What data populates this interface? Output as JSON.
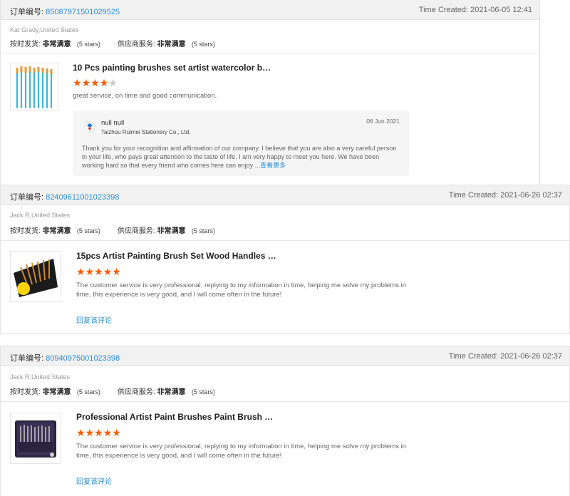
{
  "orders": [
    {
      "order_label": "订单编号:",
      "order_number": "85087971501029525",
      "time_created": "Time Created: 2021-06-05 12:41",
      "buyer": "Kat Grady,United States",
      "ship_label": "按时发货:",
      "ship_rating": "非常满意",
      "ship_stars": "(5 stars)",
      "service_label": "供应商服务:",
      "service_rating": "非常满意",
      "service_stars": "(5 stars)",
      "product_title": "10 Pcs painting brushes set artist watercolor b…",
      "rating_stars": 4,
      "comment": "great service, on time and good communication.",
      "reply": {
        "name": "null null",
        "company": "Taizhou Ruimei Stationery Co., Ltd.",
        "date": "06 Jun 2021",
        "text": "Thank you for your recognition and affirmation of our company. I believe that you are also a very careful person in your life, who pays great attention to the taste of life. I am very happy to meet you here. We have been working hard so that every friend who comes here can enjoy ...",
        "more": "查看更多"
      }
    },
    {
      "order_label": "订单编号:",
      "order_number": "82409611001023398",
      "time_created": "Time Created: 2021-06-26 02:37",
      "buyer": "Jack R,United States",
      "ship_label": "按时发货:",
      "ship_rating": "非常满意",
      "ship_stars": "(5 stars)",
      "service_label": "供应商服务:",
      "service_rating": "非常满意",
      "service_stars": "(5 stars)",
      "product_title": "15pcs Artist Painting Brush Set Wood Handles …",
      "rating_stars": 5,
      "comment": "The customer service is very professional, replying to my information in time, helping me solve my problems in time, this experience is very good, and I will come often in the future!",
      "reply_link": "回复该评论"
    },
    {
      "order_label": "订单编号:",
      "order_number": "80940975001023398",
      "time_created": "Time Created: 2021-06-26 02:37",
      "buyer": "Jack R,United States",
      "ship_label": "按时发货:",
      "ship_rating": "非常满意",
      "ship_stars": "(5 stars)",
      "service_label": "供应商服务:",
      "service_rating": "非常满意",
      "service_stars": "(5 stars)",
      "product_title": "Professional Artist Paint Brushes Paint Brush …",
      "rating_stars": 5,
      "comment": "The customer service is very professional, replying to my information in time, helping me solve my problems in time, this experience is very good, and I will come often in the future!",
      "reply_link": "回复该评论"
    }
  ],
  "icons": {
    "star": "star-icon",
    "supplier_logo": "supplier-logo-icon"
  },
  "colors": {
    "accent_link": "#2a8fd6",
    "star_on": "#ff5a00",
    "star_off": "#c8c8c8",
    "header_bg": "#f1f1f1"
  }
}
